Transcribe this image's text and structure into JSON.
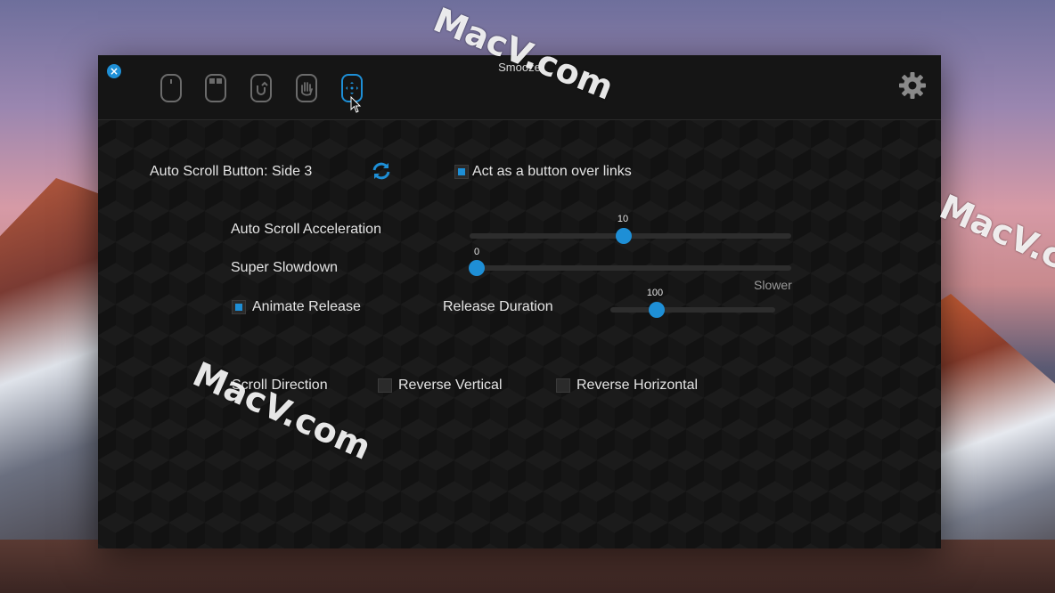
{
  "window": {
    "title": "Smooze",
    "tabs": [
      {
        "icon": "mouse-icon",
        "active": false
      },
      {
        "icon": "mouse-buttons-icon",
        "active": false
      },
      {
        "icon": "mouse-gesture-icon",
        "active": false
      },
      {
        "icon": "mouse-grab-icon",
        "active": false
      },
      {
        "icon": "mouse-autoscroll-icon",
        "active": true
      }
    ]
  },
  "autoscroll": {
    "button_label": "Auto Scroll Button: Side 3",
    "act_as_button_label": "Act as a button over links",
    "act_as_button_checked": true,
    "acceleration": {
      "label": "Auto Scroll Acceleration",
      "value": "10",
      "fraction": 0.48
    },
    "slowdown": {
      "label": "Super Slowdown",
      "value": "0",
      "fraction": 0.0,
      "max_label": "Slower"
    },
    "animate_release": {
      "label": "Animate Release",
      "checked": true
    },
    "release_duration": {
      "label": "Release Duration",
      "value": "100",
      "fraction": 0.28
    }
  },
  "scroll_direction": {
    "label": "Scroll Direction",
    "reverse_vertical": {
      "label": "Reverse Vertical",
      "checked": false
    },
    "reverse_horizontal": {
      "label": "Reverse Horizontal",
      "checked": false
    }
  },
  "watermark": "MacV.com",
  "colors": {
    "accent": "#1e8fd6",
    "window_bg": "#121212"
  }
}
